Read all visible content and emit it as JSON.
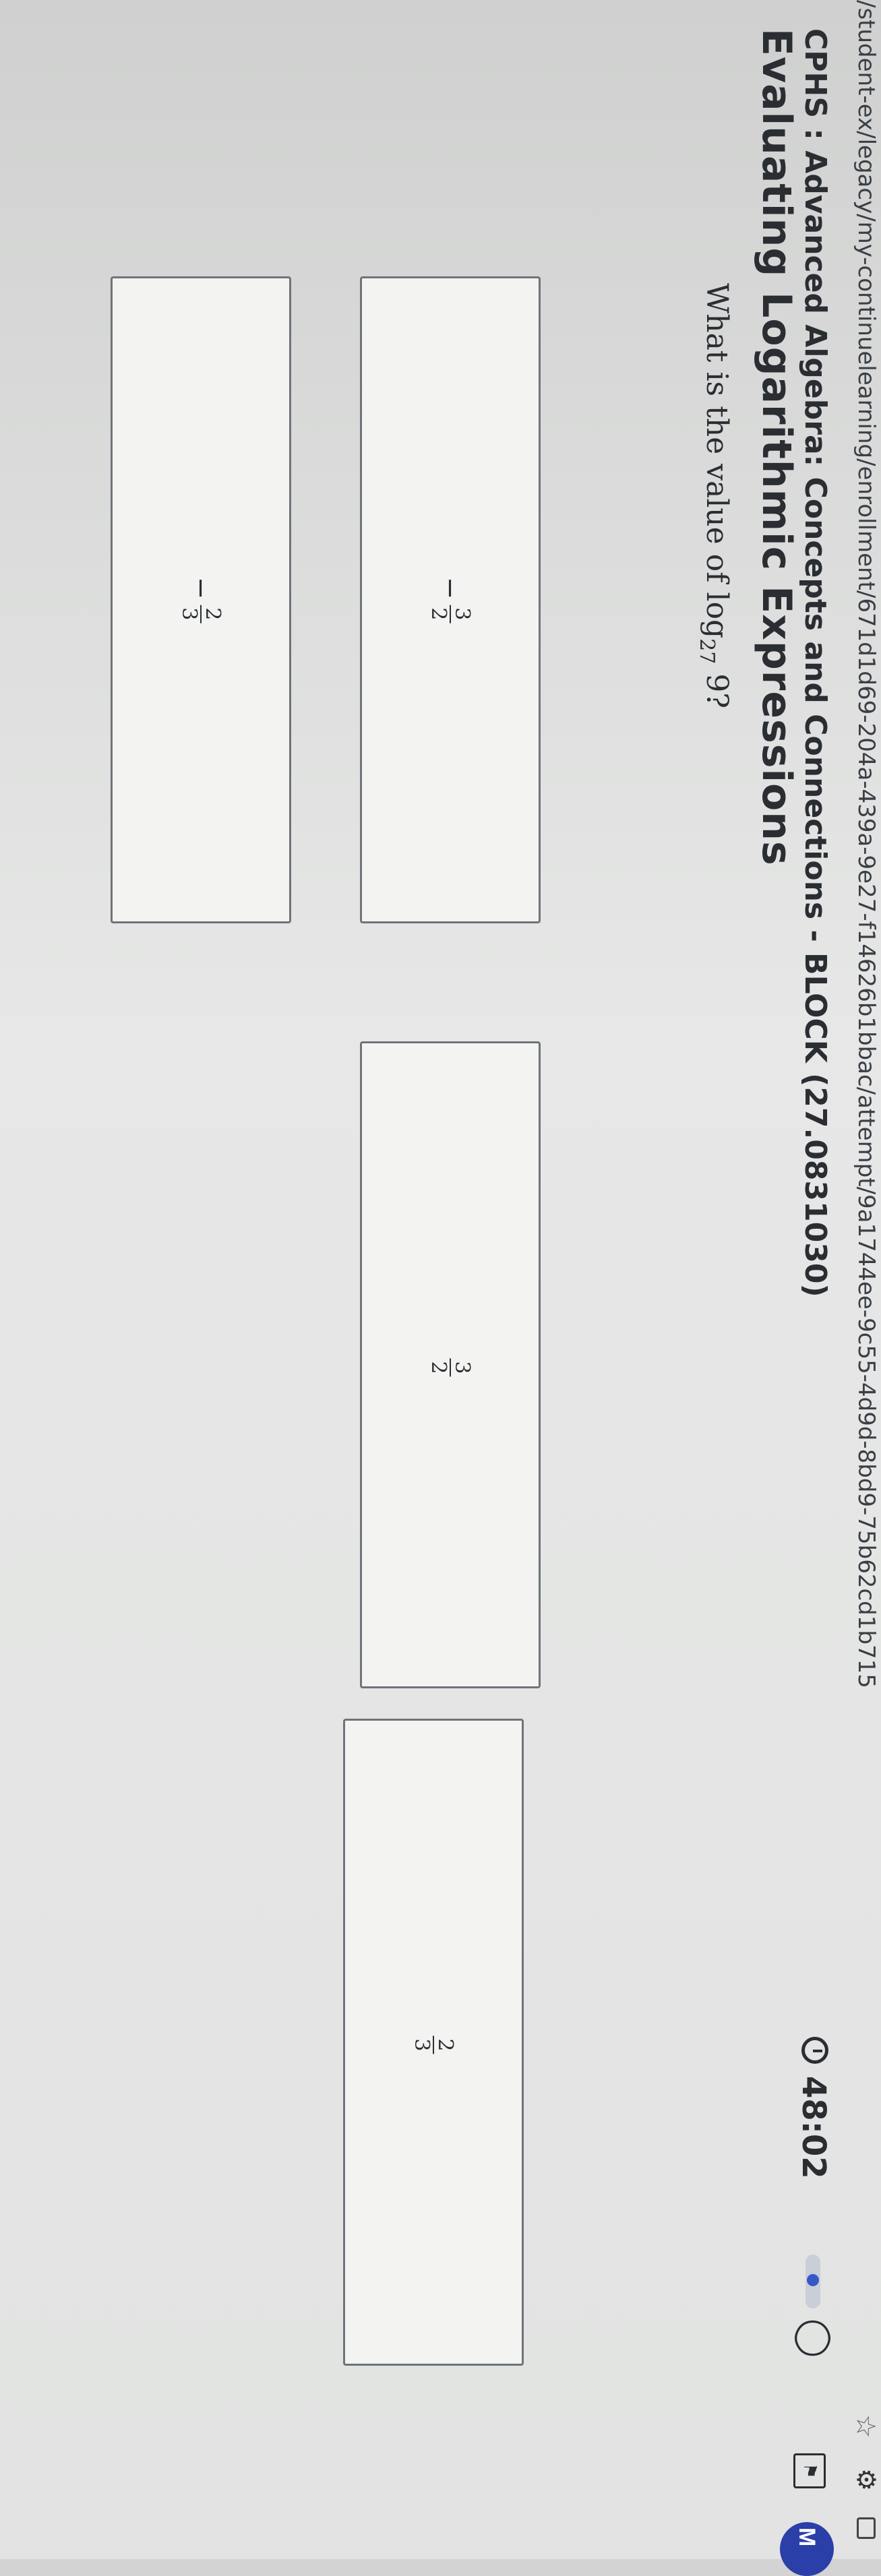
{
  "browser": {
    "url_text": "/student-ex/legacy/my-continuelearning/enrollment/671d1d69-204a-439a-9e27-f14626b1bbac/attempt/9a1744ee-9c55-4d9d-8bd9-75b62cd1b715"
  },
  "header": {
    "course_title": "CPHS : Advanced Algebra: Concepts and Connections - BLOCK (27.0831030)",
    "lesson_title": "Evaluating Logarithmic Expressions",
    "timer": "48:02",
    "avatar_initial": "M"
  },
  "question": {
    "prefix": "What is the value of log",
    "base": "27",
    "argument": "9?"
  },
  "choices": [
    {
      "sign": "−",
      "numerator": "3",
      "denominator": "2"
    },
    {
      "sign": "−",
      "numerator": "2",
      "denominator": "3"
    },
    {
      "sign": "",
      "numerator": "3",
      "denominator": "2"
    },
    {
      "sign": "",
      "numerator": "2",
      "denominator": "3"
    }
  ],
  "colors": {
    "accent": "#3759c7",
    "avatar": "#2b3fa8"
  },
  "icons": [
    "star-icon",
    "extension-icon",
    "window-icon",
    "timer-icon",
    "hint-icon",
    "flag-icon"
  ]
}
